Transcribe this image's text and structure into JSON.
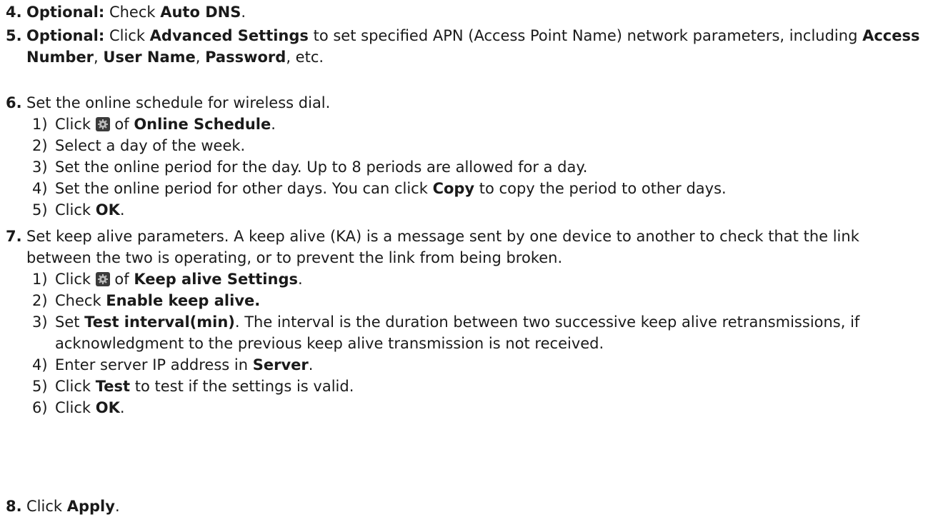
{
  "steps": [
    {
      "num": "4.",
      "parts": {
        "p0": "Optional:",
        "p1": " Check ",
        "p2": "Auto DNS",
        "p3": "."
      }
    },
    {
      "num": "5.",
      "parts": {
        "p0": "Optional:",
        "p1": " Click ",
        "p2": "Advanced Settings",
        "p3": " to set specified APN (Access Point Name) network parameters, including ",
        "p4": "Access Number",
        "p5": ", ",
        "p6": "User Name",
        "p7": ", ",
        "p8": "Password",
        "p9": ", etc."
      }
    },
    {
      "num": "6.",
      "text": "Set the online schedule for wireless dial.",
      "subs": [
        {
          "num": "1)",
          "a": "Click ",
          "b": " of ",
          "c": "Online Schedule",
          "d": "."
        },
        {
          "num": "2)",
          "text": "Select a day of the week."
        },
        {
          "num": "3)",
          "text": "Set the online period for the day. Up to 8 periods are allowed for a day."
        },
        {
          "num": "4)",
          "a": "Set the online period for other days. You can click ",
          "b": "Copy",
          "c": " to copy the period to other days."
        },
        {
          "num": "5)",
          "a": "Click ",
          "b": "OK",
          "c": "."
        }
      ]
    },
    {
      "num": "7.",
      "text": "Set keep alive parameters. A keep alive (KA) is a message sent by one device to another to check that the link between the two is operating, or to prevent the link from being broken.",
      "subs": [
        {
          "num": "1)",
          "a": "Click ",
          "b": " of ",
          "c": "Keep alive Settings",
          "d": "."
        },
        {
          "num": "2)",
          "a": "Check ",
          "b": "Enable keep alive."
        },
        {
          "num": "3)",
          "a": "Set ",
          "b": "Test interval(min)",
          "c": ". The interval is the duration between two successive keep alive retransmissions, if acknowledgment to the previous keep alive transmission is not received."
        },
        {
          "num": "4)",
          "a": "Enter server IP address in ",
          "b": "Server",
          "c": "."
        },
        {
          "num": "5)",
          "a": "Click ",
          "b": "Test",
          "c": " to test if the settings is valid."
        },
        {
          "num": "6)",
          "a": "Click ",
          "b": "OK",
          "c": "."
        }
      ]
    },
    {
      "num": "8.",
      "parts": {
        "p0": "Click ",
        "p1": "Apply",
        "p2": "."
      }
    }
  ],
  "icons": {
    "settings": "gear-icon"
  }
}
